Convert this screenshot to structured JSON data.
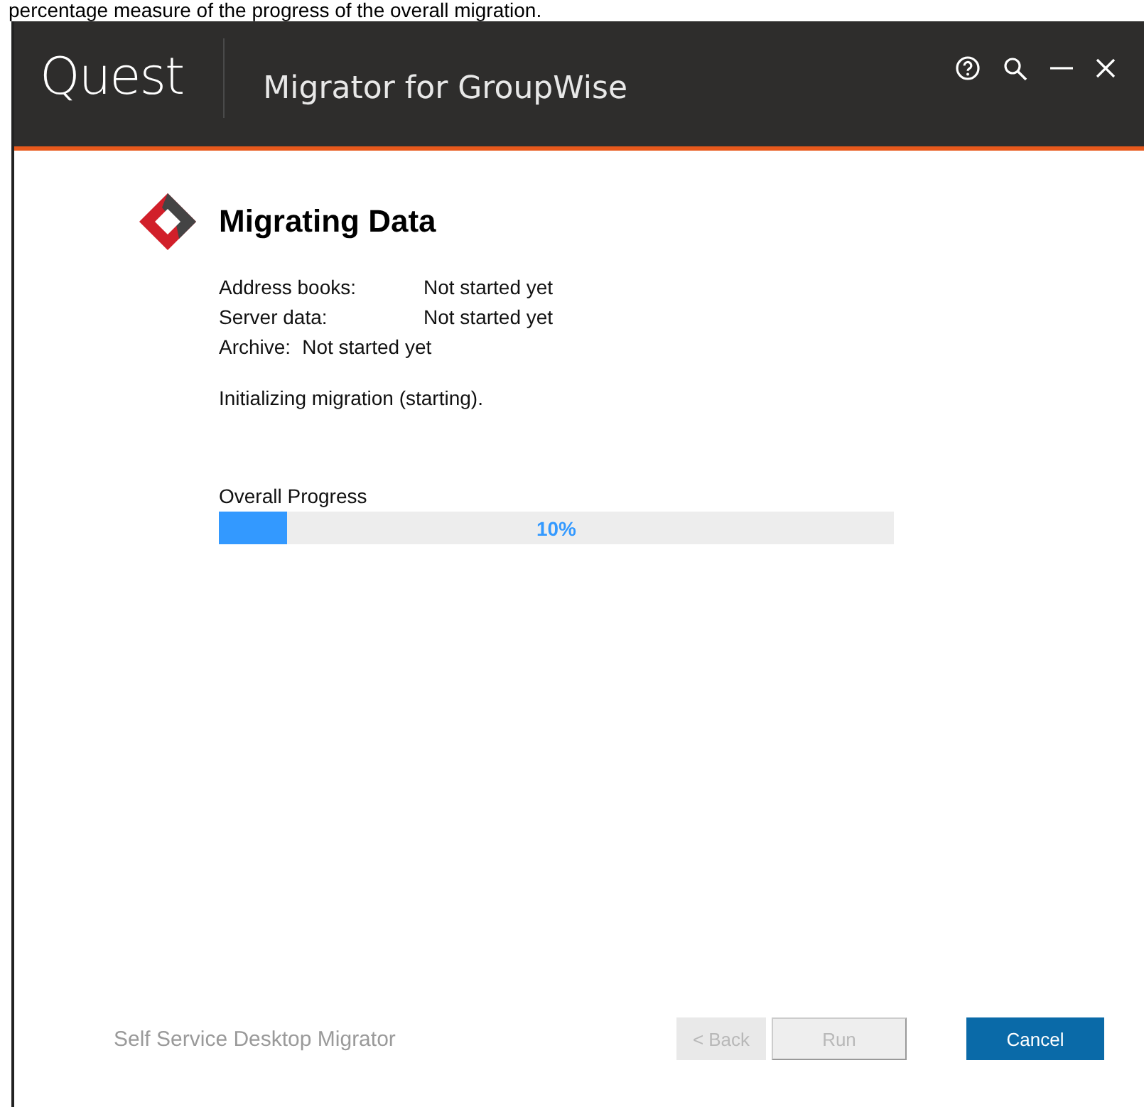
{
  "caption": "percentage measure of the progress of the overall migration.",
  "window": {
    "logo": "Quest",
    "title": "Migrator for GroupWise"
  },
  "heading": "Migrating Data",
  "statuses": [
    {
      "label": "Address books:",
      "value": "Not started yet"
    },
    {
      "label": "Server data:",
      "value": "Not started yet"
    },
    {
      "label": "Archive:",
      "value": "Not started yet"
    }
  ],
  "message": "Initializing migration (starting).",
  "progress": {
    "label": "Overall Progress",
    "level": 0.1,
    "reading": "10%"
  },
  "footer": "Self Service Desktop Migrator",
  "buttons": [
    {
      "label": "< Back",
      "kind": "plain",
      "disabled": true
    },
    {
      "label": "Run",
      "kind": "outlined",
      "disabled": true
    },
    {
      "label": "Cancel",
      "kind": "primary",
      "disabled": false
    }
  ]
}
